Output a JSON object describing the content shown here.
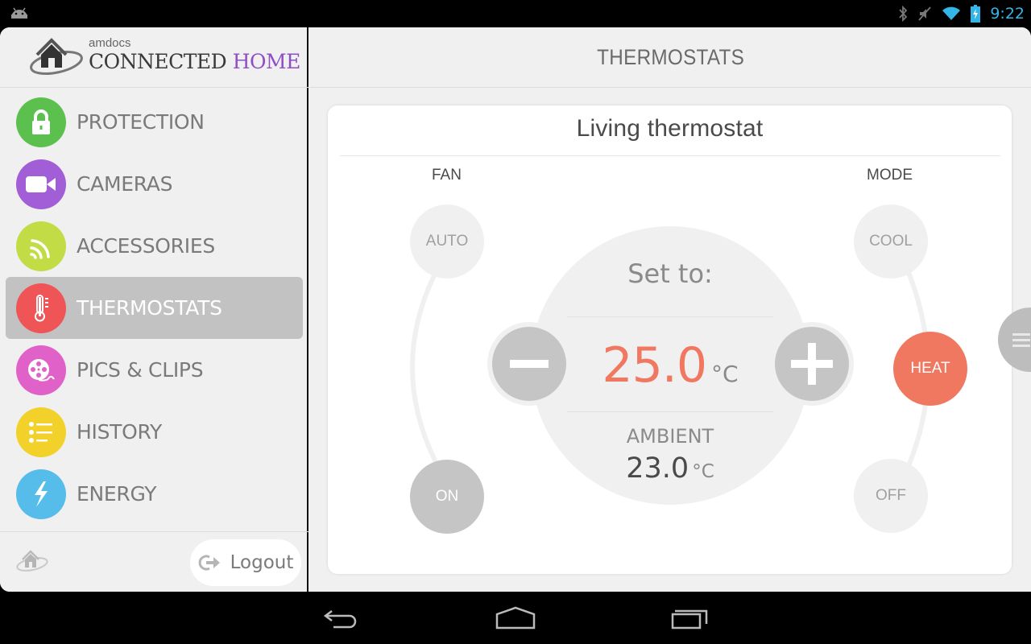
{
  "status_bar": {
    "time": "9:22",
    "icons": [
      "android-icon",
      "bluetooth-icon",
      "muted-icon",
      "wifi-icon",
      "battery-charging-icon"
    ]
  },
  "brand": {
    "company": "amdocs",
    "title_part1": "CONNECTED",
    "title_part2": "HOME",
    "accent_color": "#8e4ec6"
  },
  "sidebar": {
    "items": [
      {
        "label": "PROTECTION",
        "icon": "lock-icon",
        "color": "#5cc04f",
        "active": false
      },
      {
        "label": "CAMERAS",
        "icon": "video-camera-icon",
        "color": "#a15ed6",
        "active": false
      },
      {
        "label": "ACCESSORIES",
        "icon": "wireless-signal-icon",
        "color": "#c2dc46",
        "active": false
      },
      {
        "label": "THERMOSTATS",
        "icon": "thermometer-icon",
        "color": "#ef5457",
        "active": true
      },
      {
        "label": "PICS & CLIPS",
        "icon": "film-reel-icon",
        "color": "#e062c9",
        "active": false
      },
      {
        "label": "HISTORY",
        "icon": "list-icon",
        "color": "#f2d22a",
        "active": false
      },
      {
        "label": "ENERGY",
        "icon": "lightning-icon",
        "color": "#56bce9",
        "active": false
      }
    ],
    "logout_label": "Logout"
  },
  "main": {
    "title": "THERMOSTATS",
    "card": {
      "title": "Living thermostat",
      "fan": {
        "label": "FAN",
        "options": [
          "AUTO",
          "ON"
        ],
        "selected": "ON"
      },
      "mode": {
        "label": "MODE",
        "options": [
          "COOL",
          "HEAT",
          "OFF"
        ],
        "selected": "HEAT",
        "selected_color": "#f07860"
      },
      "set_to_label": "Set to:",
      "setpoint_value": "25.0",
      "setpoint_unit": "°C",
      "ambient_label": "AMBIENT",
      "ambient_value": "23.0",
      "ambient_unit": "°C"
    }
  },
  "system_nav": [
    "back-icon",
    "home-icon",
    "recent-apps-icon"
  ]
}
